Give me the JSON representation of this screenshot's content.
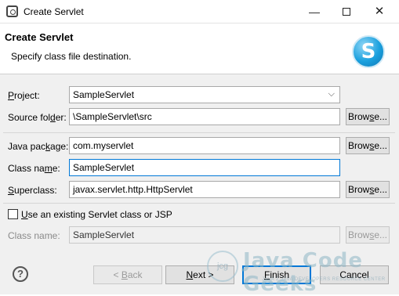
{
  "window": {
    "title": "Create Servlet",
    "minimize": "—",
    "close": "✕"
  },
  "header": {
    "title": "Create Servlet",
    "subtitle": "Specify class file destination.",
    "logo_letter": "S"
  },
  "form": {
    "project_label_pre": "",
    "project_label_u": "P",
    "project_label_post": "roject:",
    "project_value": "SampleServlet",
    "source_folder_label_pre": "Source fol",
    "source_folder_label_u": "d",
    "source_folder_label_post": "er:",
    "source_folder_value": "\\SampleServlet\\src",
    "java_package_label_pre": "Java pac",
    "java_package_label_u": "k",
    "java_package_label_post": "age:",
    "java_package_value": "com.myservlet",
    "class_name_label_pre": "Class na",
    "class_name_label_u": "m",
    "class_name_label_post": "e:",
    "class_name_value": "SampleServlet",
    "superclass_label_pre": "",
    "superclass_label_u": "S",
    "superclass_label_post": "uperclass:",
    "superclass_value": "javax.servlet.http.HttpServlet",
    "browse_pre": "Brow",
    "browse_u": "s",
    "browse_post": "e...",
    "use_existing_pre": "",
    "use_existing_u": "U",
    "use_existing_post": "se an existing Servlet class or JSP",
    "existing_class_label": "Class name:",
    "existing_class_value": "SampleServlet",
    "existing_browse_pre": "Brow",
    "existing_browse_u": "s",
    "existing_browse_post": "e...",
    "use_existing_checked": false
  },
  "footer": {
    "help": "?",
    "back_pre": "< ",
    "back_u": "B",
    "back_post": "ack",
    "next_pre": "",
    "next_u": "N",
    "next_post": "ext >",
    "finish_pre": "",
    "finish_u": "F",
    "finish_post": "inish",
    "cancel": "Cancel"
  },
  "watermark": {
    "badge": "jcg",
    "name": "Java Code Geeks",
    "tagline": "JAVA 2 JAVA DEVELOPERS RESOURCE CENTER"
  },
  "colors": {
    "focus_border": "#0078d7",
    "dialog_bg": "#f0f0f0",
    "logo": "#1aa0de"
  }
}
